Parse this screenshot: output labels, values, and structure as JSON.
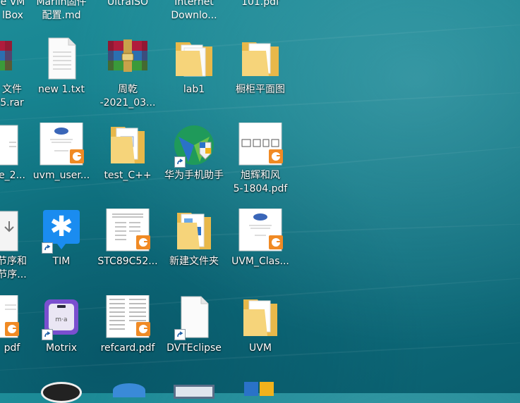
{
  "top_row": [
    {
      "label": "e VM\nlBox"
    },
    {
      "label": "Marlin固件\n配置.md"
    },
    {
      "label": "UltraISO"
    },
    {
      "label": "Internet\nDownlo..."
    },
    {
      "label": "101.pdf"
    }
  ],
  "row1": [
    {
      "label": "文件\n5.rar"
    },
    {
      "label": "new 1.txt"
    },
    {
      "label": "周乾\n-2021_03..."
    },
    {
      "label": "lab1"
    },
    {
      "label": "橱柜平面图"
    }
  ],
  "row2": [
    {
      "label": "e_2..."
    },
    {
      "label": "uvm_user..."
    },
    {
      "label": "test_C++"
    },
    {
      "label": "华为手机助手"
    },
    {
      "label": "旭辉和风\n5-1804.pdf"
    }
  ],
  "row3": [
    {
      "label": "节序和\n节序..."
    },
    {
      "label": "TIM"
    },
    {
      "label": "STC89C52..."
    },
    {
      "label": "新建文件夹"
    },
    {
      "label": "UVM_Clas..."
    }
  ],
  "row4": [
    {
      "label": "pdf"
    },
    {
      "label": "Motrix"
    },
    {
      "label": "refcard.pdf"
    },
    {
      "label": "DVTEclipse"
    },
    {
      "label": "UVM"
    }
  ],
  "tim_glyph": "✱",
  "motrix_glyph": "m·a"
}
